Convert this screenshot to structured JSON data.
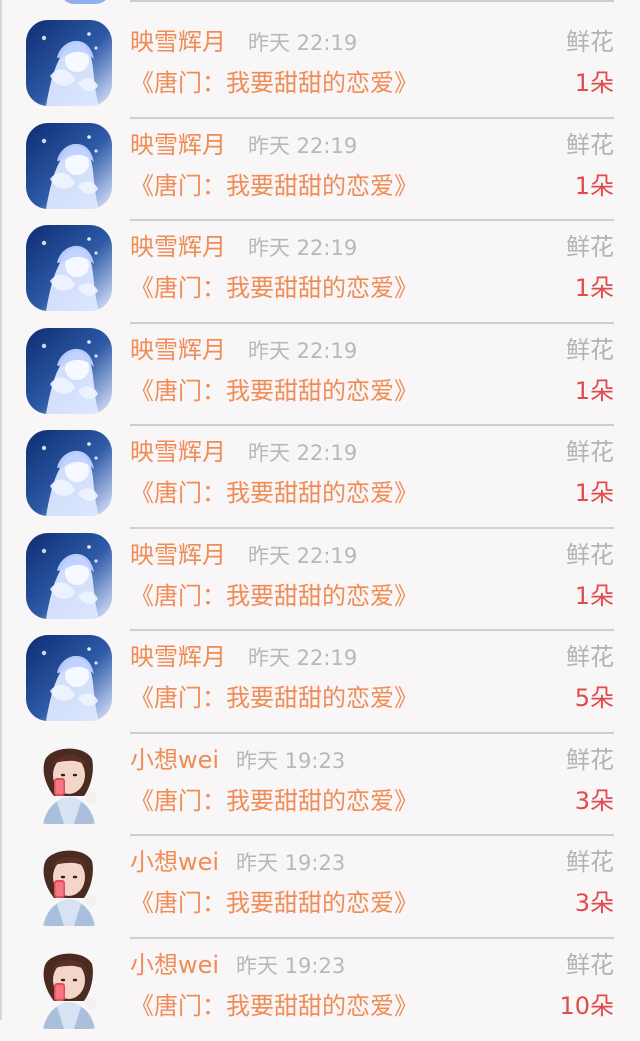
{
  "records": [
    {
      "avatar_icon": "anime-girl-avatar-icon",
      "user": "映雪辉月",
      "time": "昨天 22:19",
      "gift_type": "鲜花",
      "book_title": "《唐门：我要甜甜的恋爱》",
      "gift_count": "1朵"
    },
    {
      "avatar_icon": "anime-girl-avatar-icon",
      "user": "映雪辉月",
      "time": "昨天 22:19",
      "gift_type": "鲜花",
      "book_title": "《唐门：我要甜甜的恋爱》",
      "gift_count": "1朵"
    },
    {
      "avatar_icon": "anime-girl-avatar-icon",
      "user": "映雪辉月",
      "time": "昨天 22:19",
      "gift_type": "鲜花",
      "book_title": "《唐门：我要甜甜的恋爱》",
      "gift_count": "1朵"
    },
    {
      "avatar_icon": "anime-girl-avatar-icon",
      "user": "映雪辉月",
      "time": "昨天 22:19",
      "gift_type": "鲜花",
      "book_title": "《唐门：我要甜甜的恋爱》",
      "gift_count": "1朵"
    },
    {
      "avatar_icon": "anime-girl-avatar-icon",
      "user": "映雪辉月",
      "time": "昨天 22:19",
      "gift_type": "鲜花",
      "book_title": "《唐门：我要甜甜的恋爱》",
      "gift_count": "1朵"
    },
    {
      "avatar_icon": "anime-girl-avatar-icon",
      "user": "映雪辉月",
      "time": "昨天 22:19",
      "gift_type": "鲜花",
      "book_title": "《唐门：我要甜甜的恋爱》",
      "gift_count": "1朵"
    },
    {
      "avatar_icon": "anime-girl-avatar-icon",
      "user": "映雪辉月",
      "time": "昨天 22:19",
      "gift_type": "鲜花",
      "book_title": "《唐门：我要甜甜的恋爱》",
      "gift_count": "5朵"
    },
    {
      "avatar_icon": "girl-selfie-avatar-icon",
      "user": "小想wei",
      "time": "昨天 19:23",
      "gift_type": "鲜花",
      "book_title": "《唐门：我要甜甜的恋爱》",
      "gift_count": "3朵"
    },
    {
      "avatar_icon": "girl-selfie-avatar-icon",
      "user": "小想wei",
      "time": "昨天 19:23",
      "gift_type": "鲜花",
      "book_title": "《唐门：我要甜甜的恋爱》",
      "gift_count": "3朵"
    },
    {
      "avatar_icon": "girl-selfie-avatar-icon",
      "user": "小想wei",
      "time": "昨天 19:23",
      "gift_type": "鲜花",
      "book_title": "《唐门：我要甜甜的恋爱》",
      "gift_count": "10朵"
    }
  ],
  "colors": {
    "name": "#f08c56",
    "book": "#f08c56",
    "time": "#b8b8b8",
    "gift_type": "#b3b3b3",
    "count": "#e24b4b",
    "background": "#f8f6f7",
    "divider": "#cfcfcf"
  }
}
